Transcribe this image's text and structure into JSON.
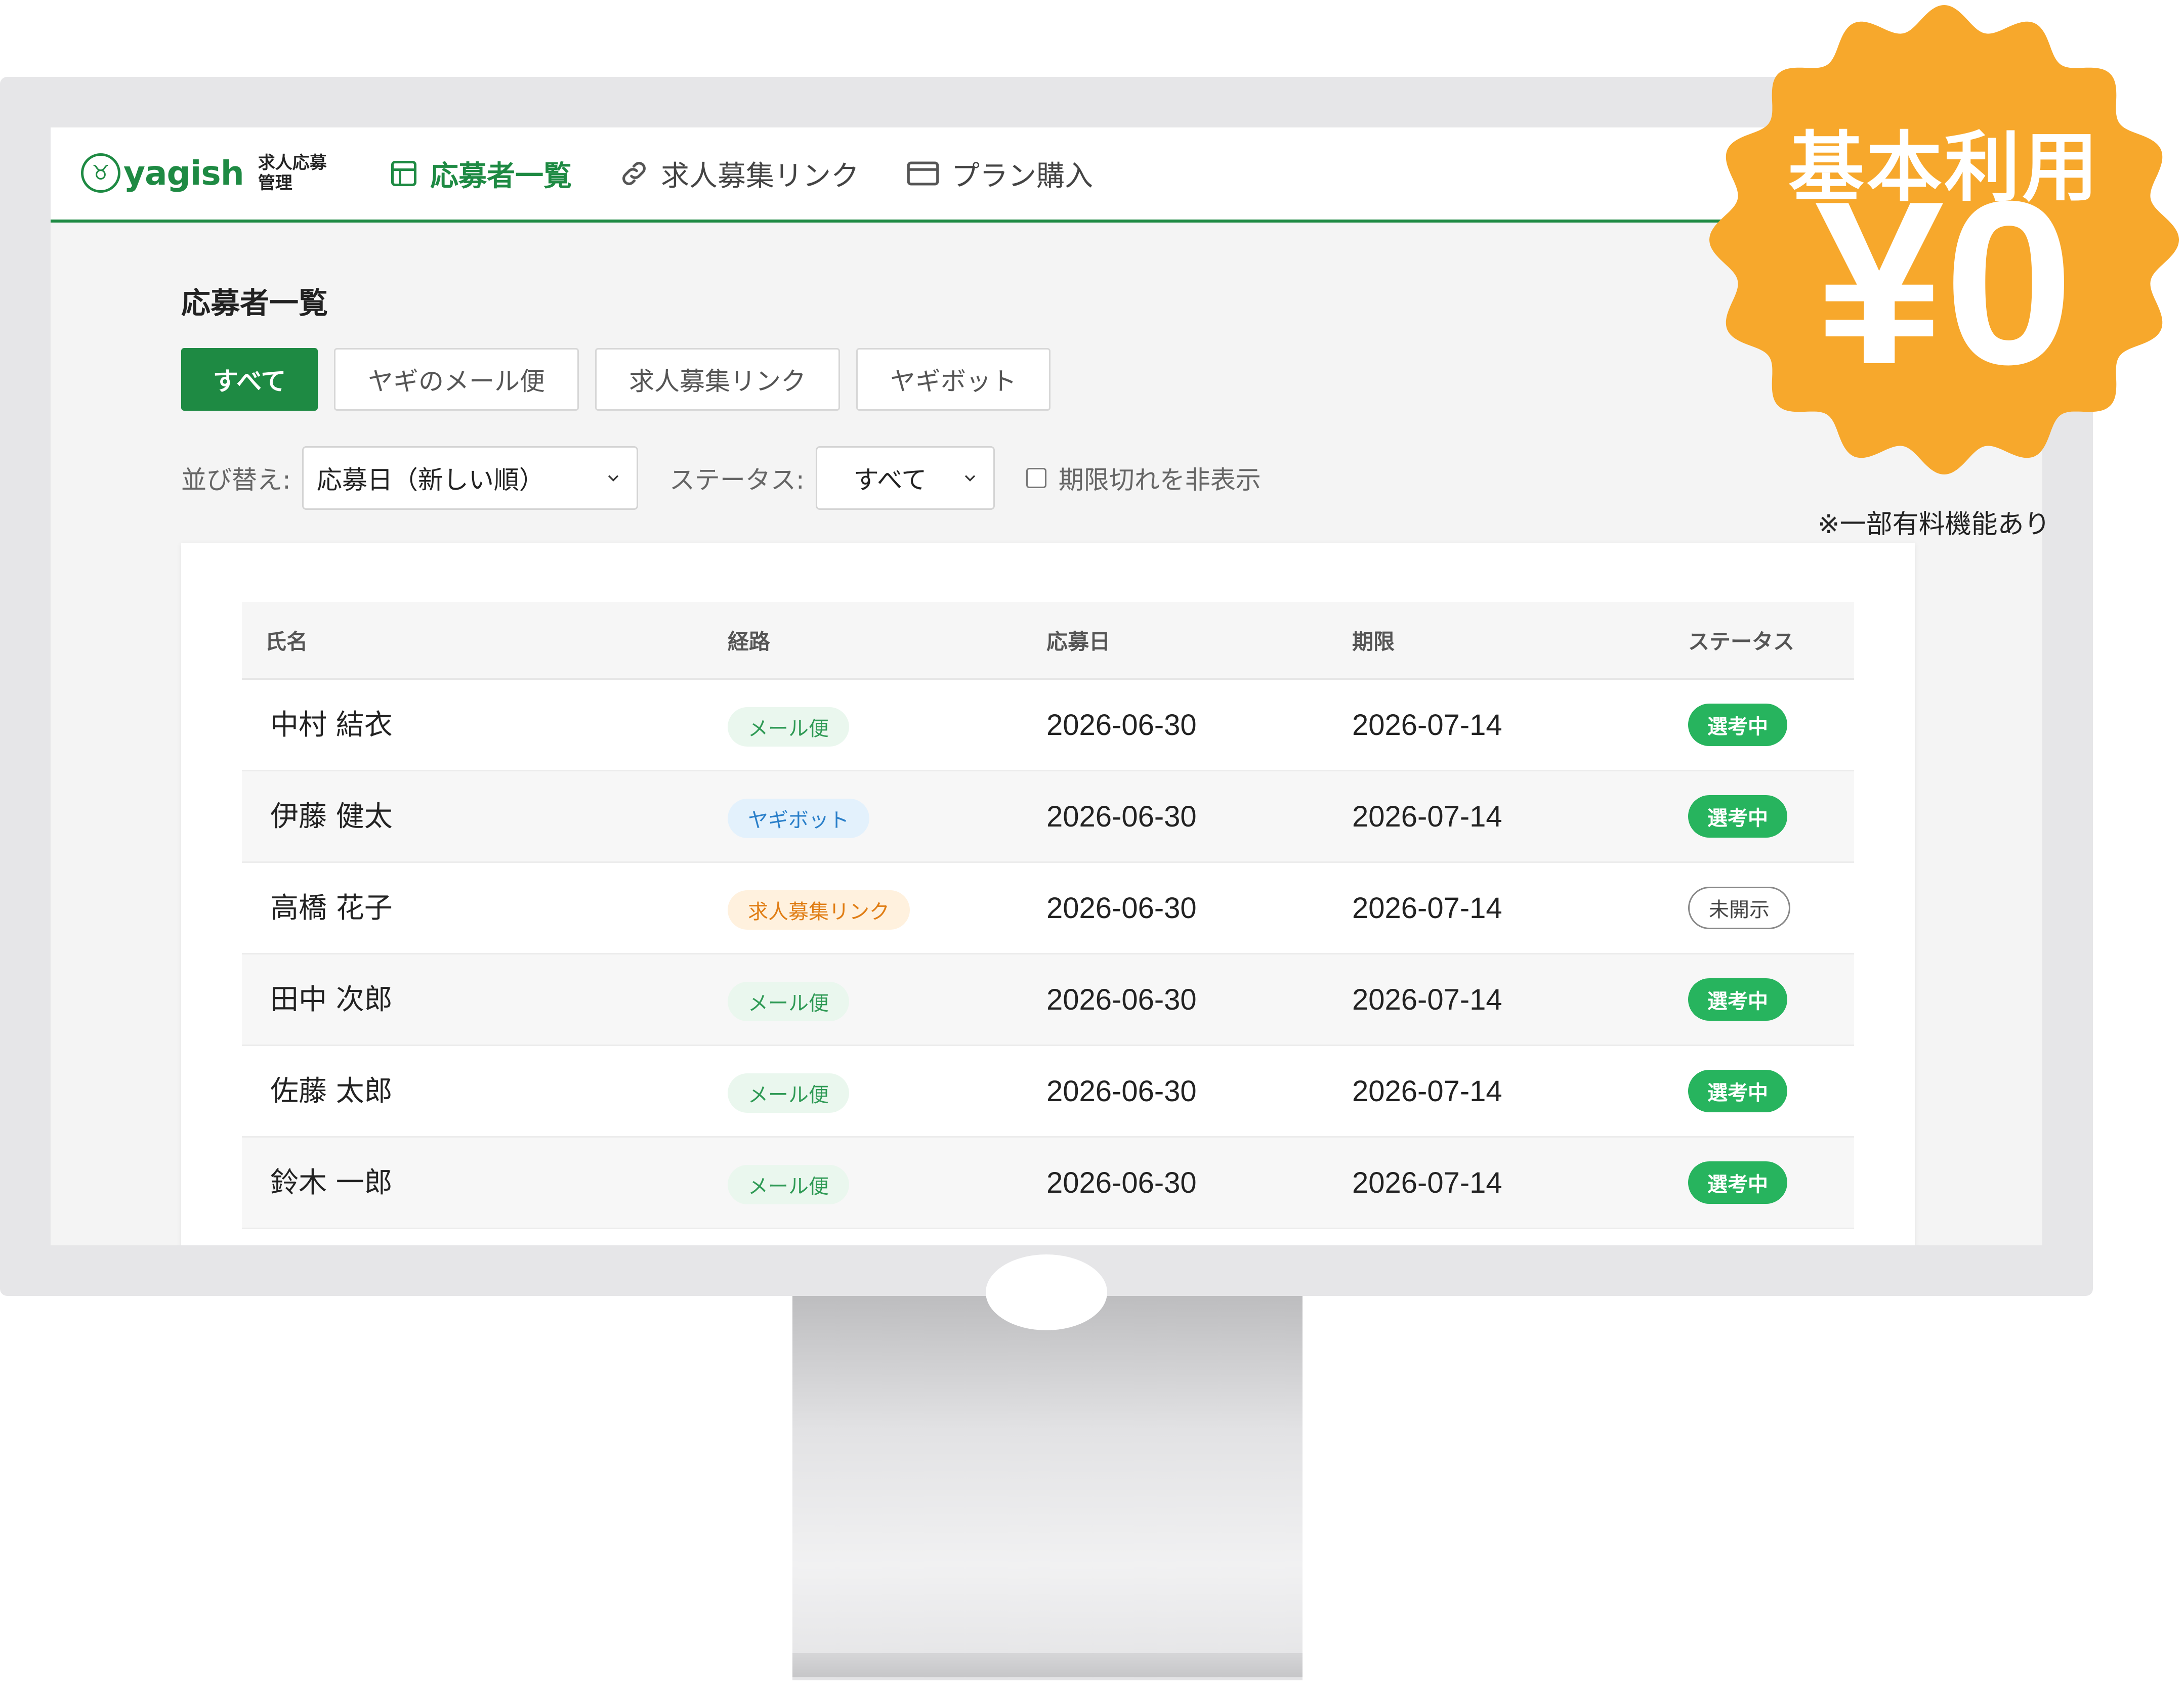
{
  "header": {
    "logo_word": "yagish",
    "logo_sub_line1": "求人応募",
    "logo_sub_line2": "管理",
    "nav": [
      {
        "label": "応募者一覧",
        "icon": "table-icon",
        "active": true
      },
      {
        "label": "求人募集リンク",
        "icon": "link-icon",
        "active": false
      },
      {
        "label": "プラン購入",
        "icon": "credit-card-icon",
        "active": false
      }
    ]
  },
  "page": {
    "title": "応募者一覧",
    "tabs": [
      "すべて",
      "ヤギのメール便",
      "求人募集リンク",
      "ヤギボット"
    ],
    "active_tab": "すべて",
    "sort_label": "並び替え:",
    "sort_value": "応募日（新しい順）",
    "status_label": "ステータス:",
    "status_value": "すべて",
    "hide_expired_label": "期限切れを非表示",
    "hide_expired_checked": false
  },
  "table": {
    "headers": [
      "氏名",
      "経路",
      "応募日",
      "期限",
      "ステータス"
    ],
    "rows": [
      {
        "name": "中村 結衣",
        "route": "メール便",
        "applied": "2026-06-30",
        "deadline": "2026-07-14",
        "status": "選考中"
      },
      {
        "name": "伊藤 健太",
        "route": "ヤギボット",
        "applied": "2026-06-30",
        "deadline": "2026-07-14",
        "status": "選考中"
      },
      {
        "name": "高橋 花子",
        "route": "求人募集リンク",
        "applied": "2026-06-30",
        "deadline": "2026-07-14",
        "status": "未開示"
      },
      {
        "name": "田中 次郎",
        "route": "メール便",
        "applied": "2026-06-30",
        "deadline": "2026-07-14",
        "status": "選考中"
      },
      {
        "name": "佐藤 太郎",
        "route": "メール便",
        "applied": "2026-06-30",
        "deadline": "2026-07-14",
        "status": "選考中"
      },
      {
        "name": "鈴木 一郎",
        "route": "メール便",
        "applied": "2026-06-30",
        "deadline": "2026-07-14",
        "status": "選考中"
      }
    ]
  },
  "badge": {
    "title": "基本利用",
    "price": "¥0",
    "note": "※一部有料機能あり"
  },
  "colors": {
    "brand_green": "#1e8a43",
    "status_green": "#27b45e",
    "badge_orange": "#f7a82c",
    "route_mail_bg": "#eaf7ee",
    "route_bot_bg": "#e3f1fc",
    "route_link_bg": "#fff1de"
  }
}
